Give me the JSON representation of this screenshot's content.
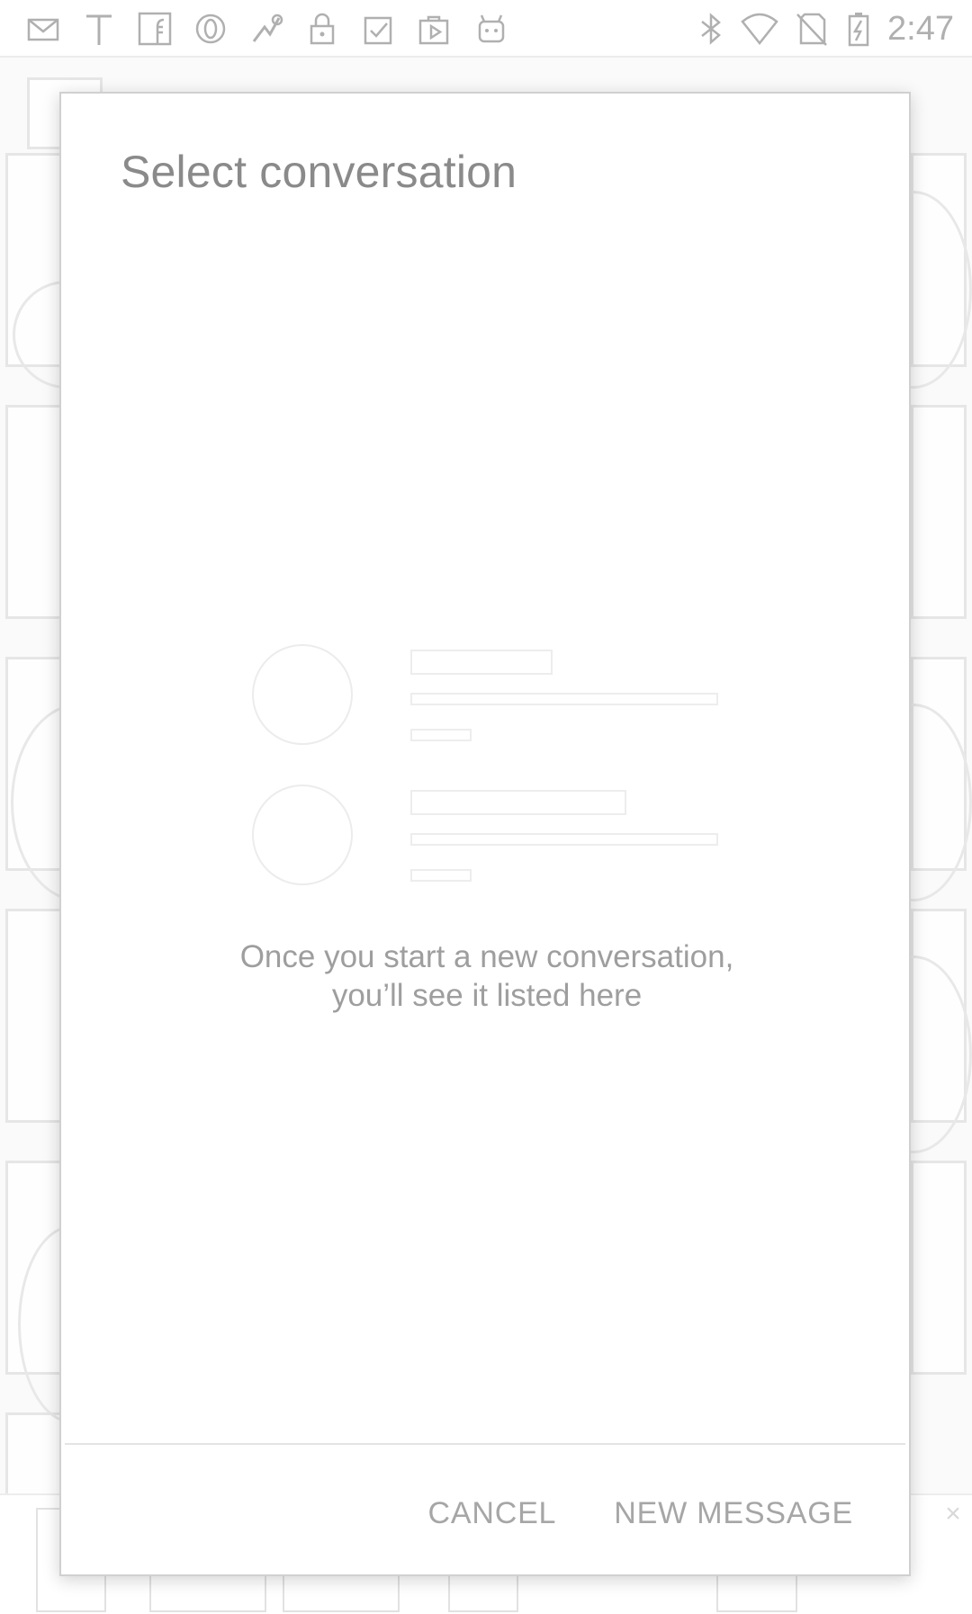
{
  "status_bar": {
    "time": "2:47",
    "left_icons": [
      "email-icon",
      "text-t-icon",
      "facebook-icon",
      "opera-icon",
      "fake-gps-icon",
      "lock-icon",
      "clipboard-check-icon",
      "play-store-icon",
      "android-icon"
    ],
    "right_icons": [
      "bluetooth-icon",
      "wifi-icon",
      "no-sim-icon",
      "battery-charging-icon"
    ]
  },
  "dialog": {
    "title": "Select conversation",
    "empty_message_line1": "Once you start a new conversation,",
    "empty_message_line2": "you’ll see it listed here",
    "cancel_label": "CANCEL",
    "new_message_label": "NEW MESSAGE"
  },
  "colors": {
    "dialog_background": "#ffffff",
    "title_text": "#8a8a8a",
    "body_text": "#9e9e9e",
    "button_text": "#a6a6a6",
    "status_icons": "#b0b0b0"
  }
}
